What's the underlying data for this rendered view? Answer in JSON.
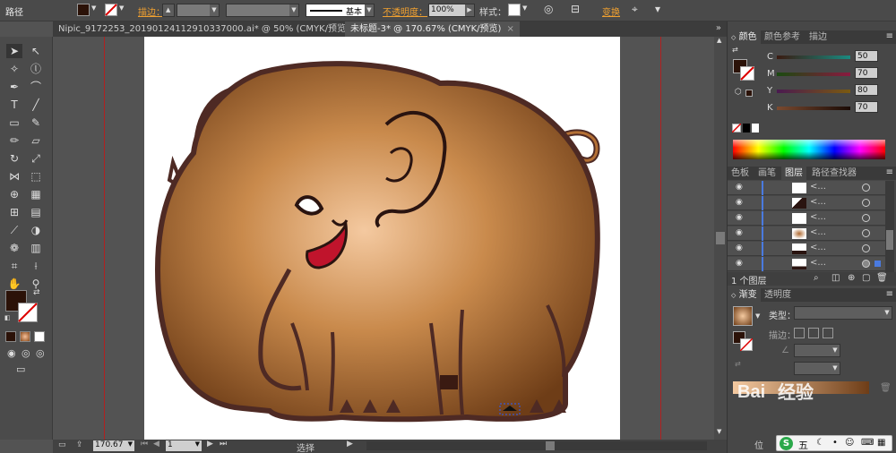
{
  "control_bar": {
    "object_type": "路径",
    "stroke_label": "描边：",
    "stroke_profile": "基本",
    "opacity_label": "不透明度：",
    "opacity_value": "100%",
    "style_label": "样式：",
    "transform_label": "变换",
    "fill_color": "#2b1208"
  },
  "tabs": [
    {
      "label": "Nipic_9172253_20190124112910337000.ai* @ 50% (CMYK/预览)",
      "close": "×"
    },
    {
      "label": "未标题-3* @ 170.67% (CMYK/预览)",
      "close": "×"
    }
  ],
  "tools": [
    "selection-tool",
    "direct-selection-tool",
    "magic-wand-tool",
    "lasso-tool",
    "pen-tool",
    "curvature-tool",
    "type-tool",
    "line-tool",
    "rectangle-tool",
    "paintbrush-tool",
    "pencil-tool",
    "eraser-tool",
    "rotate-tool",
    "scale-tool",
    "width-tool",
    "free-transform-tool",
    "shape-builder-tool",
    "perspective-grid-tool",
    "mesh-tool",
    "gradient-tool",
    "eyedropper-tool",
    "blend-tool",
    "symbol-sprayer-tool",
    "column-graph-tool",
    "artboard-tool",
    "slice-tool",
    "hand-tool",
    "zoom-tool"
  ],
  "status": {
    "zoom": "170.67",
    "page": "1",
    "tool_name": "选择"
  },
  "color_panel": {
    "tabs": [
      "颜色",
      "颜色参考",
      "描边"
    ],
    "channels": [
      {
        "name": "C",
        "value": "50",
        "gradient": "linear-gradient(90deg,#3a1a10,#1a8a80)"
      },
      {
        "name": "M",
        "value": "70",
        "gradient": "linear-gradient(90deg,#1a4a10,#8a1a40)"
      },
      {
        "name": "Y",
        "value": "80",
        "gradient": "linear-gradient(90deg,#4a1a50,#7a5a10)"
      },
      {
        "name": "K",
        "value": "70",
        "gradient": "linear-gradient(90deg,#7a4a30,#1a0a05)"
      }
    ]
  },
  "layers_panel": {
    "tabs": [
      "色板",
      "画笔",
      "图层",
      "路径查找器"
    ],
    "rows": [
      "<...",
      "<...",
      "<...",
      "<...",
      "<...",
      "<..."
    ],
    "footer": "1 个图层"
  },
  "gradient_panel": {
    "tabs": [
      "渐变",
      "透明度"
    ],
    "type_label": "类型：",
    "stroke_label": "描边："
  },
  "watermark": "经验",
  "ime": {
    "logo": "S",
    "mode": "五"
  },
  "position_label": "位"
}
